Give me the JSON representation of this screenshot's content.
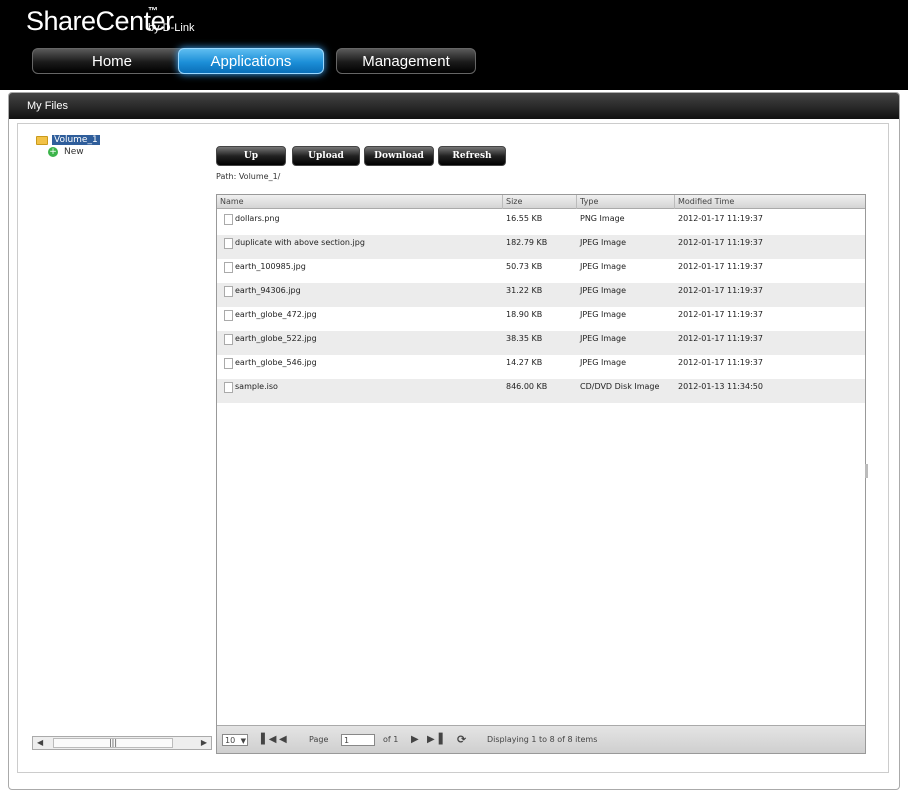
{
  "brand": {
    "name": "ShareCenter",
    "tm": "™",
    "sub": "by D-Link"
  },
  "nav": {
    "tabs": [
      {
        "label": "Home"
      },
      {
        "label": "Applications"
      },
      {
        "label": "Management"
      }
    ],
    "active": "Applications"
  },
  "panel": {
    "title": "My Files"
  },
  "tree": {
    "root": "Volume_1",
    "new_label": "New"
  },
  "toolbar": {
    "up": "Up",
    "upload": "Upload",
    "download": "Download",
    "refresh": "Refresh"
  },
  "path": {
    "label": "Path:",
    "value": "Volume_1/"
  },
  "columns": {
    "name": "Name",
    "size": "Size",
    "type": "Type",
    "modified": "Modified Time"
  },
  "files": [
    {
      "name": "dollars.png",
      "size": "16.55 KB",
      "type": "PNG Image",
      "modified": "2012-01-17 11:19:37"
    },
    {
      "name": "duplicate with above section.jpg",
      "size": "182.79 KB",
      "type": "JPEG Image",
      "modified": "2012-01-17 11:19:37"
    },
    {
      "name": "earth_100985.jpg",
      "size": "50.73 KB",
      "type": "JPEG Image",
      "modified": "2012-01-17 11:19:37"
    },
    {
      "name": "earth_94306.jpg",
      "size": "31.22 KB",
      "type": "JPEG Image",
      "modified": "2012-01-17 11:19:37"
    },
    {
      "name": "earth_globe_472.jpg",
      "size": "18.90 KB",
      "type": "JPEG Image",
      "modified": "2012-01-17 11:19:37"
    },
    {
      "name": "earth_globe_522.jpg",
      "size": "38.35 KB",
      "type": "JPEG Image",
      "modified": "2012-01-17 11:19:37"
    },
    {
      "name": "earth_globe_546.jpg",
      "size": "14.27 KB",
      "type": "JPEG Image",
      "modified": "2012-01-17 11:19:37"
    },
    {
      "name": "sample.iso",
      "size": "846.00 KB",
      "type": "CD/DVD Disk Image",
      "modified": "2012-01-13 11:34:50"
    }
  ],
  "pager": {
    "page_size": "10",
    "page_label": "Page",
    "page_value": "1",
    "of_label": "of 1",
    "display": "Displaying 1 to 8 of 8 items"
  },
  "colors": {
    "accent": "#1c8fd8",
    "header_bg": "#000000",
    "selection": "#2f5e9b"
  }
}
